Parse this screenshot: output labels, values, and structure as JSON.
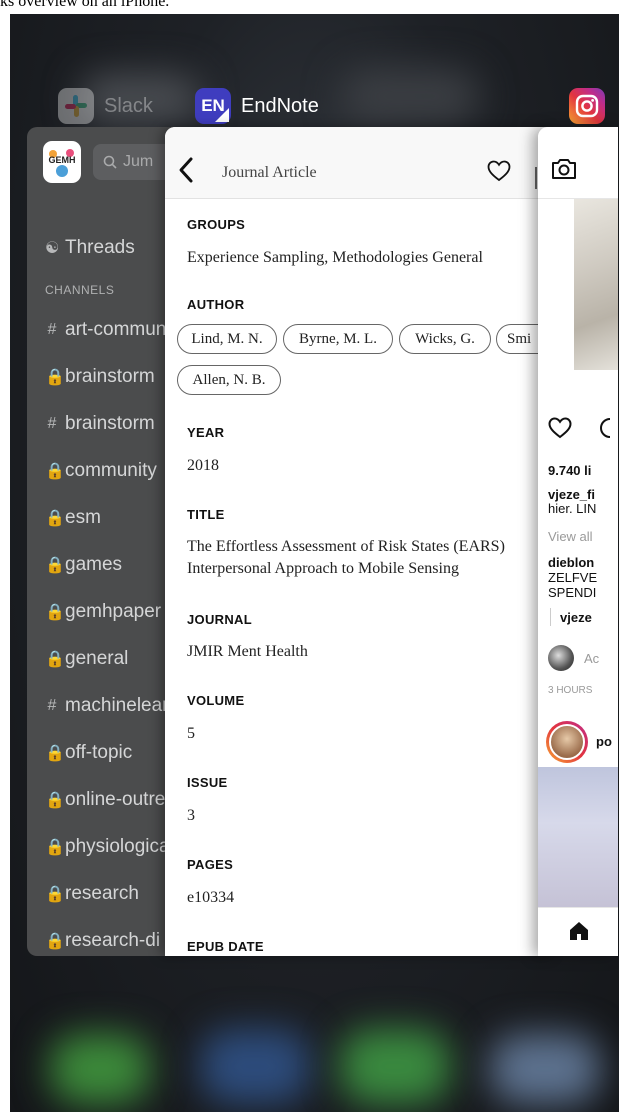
{
  "caption": "ks overview on an iPhone.",
  "apps": {
    "slack": {
      "name": "Slack"
    },
    "endnote": {
      "name": "EndNote",
      "icon_text": "EN"
    },
    "instagram": {
      "name": "Instagram"
    }
  },
  "slack": {
    "workspace_badge": "GEMH",
    "search_placeholder": "Jum",
    "threads_label": "Threads",
    "channels_heading": "CHANNELS",
    "channels": [
      {
        "prefix": "#",
        "name": "art-community"
      },
      {
        "prefix": "lock",
        "name": "brainstorm"
      },
      {
        "prefix": "#",
        "name": "brainstorm"
      },
      {
        "prefix": "lock",
        "name": "community"
      },
      {
        "prefix": "lock",
        "name": "esm"
      },
      {
        "prefix": "lock",
        "name": "games"
      },
      {
        "prefix": "lock",
        "name": "gemhpaper"
      },
      {
        "prefix": "lock",
        "name": "general"
      },
      {
        "prefix": "#",
        "name": "machinelearning"
      },
      {
        "prefix": "lock",
        "name": "off-topic"
      },
      {
        "prefix": "lock",
        "name": "online-outreach"
      },
      {
        "prefix": "lock",
        "name": "physiological"
      },
      {
        "prefix": "lock",
        "name": "research"
      },
      {
        "prefix": "lock",
        "name": "research-di"
      }
    ]
  },
  "endnote": {
    "nav_title": "Journal Article",
    "groups_label": "GROUPS",
    "groups_value": "Experience Sampling, Methodologies General",
    "author_label": "AUTHOR",
    "authors": [
      "Lind, M. N.",
      "Byrne, M. L.",
      "Wicks, G.",
      "Smi",
      "Allen, N. B."
    ],
    "year_label": "YEAR",
    "year_value": "2018",
    "title_label": "TITLE",
    "title_line1": "The Effortless Assessment of Risk States (EARS)",
    "title_line2": "Interpersonal Approach to Mobile Sensing",
    "journal_label": "JOURNAL",
    "journal_value": "JMIR Ment Health",
    "volume_label": "VOLUME",
    "volume_value": "5",
    "issue_label": "ISSUE",
    "issue_value": "3",
    "pages_label": "PAGES",
    "pages_value": "e10334",
    "epub_label": "EPUB DATE"
  },
  "instagram": {
    "likes": "9.740 li",
    "caption_user": "vjeze_fi",
    "caption_text": "hier. LIN",
    "view_all": "View all",
    "comment_user": "dieblon",
    "comment_line1": "ZELFVE",
    "comment_line2": "SPENDI",
    "reply_user": "vjeze",
    "add_comment": "Ac",
    "time": "3 HOURS",
    "next_user": "po"
  }
}
